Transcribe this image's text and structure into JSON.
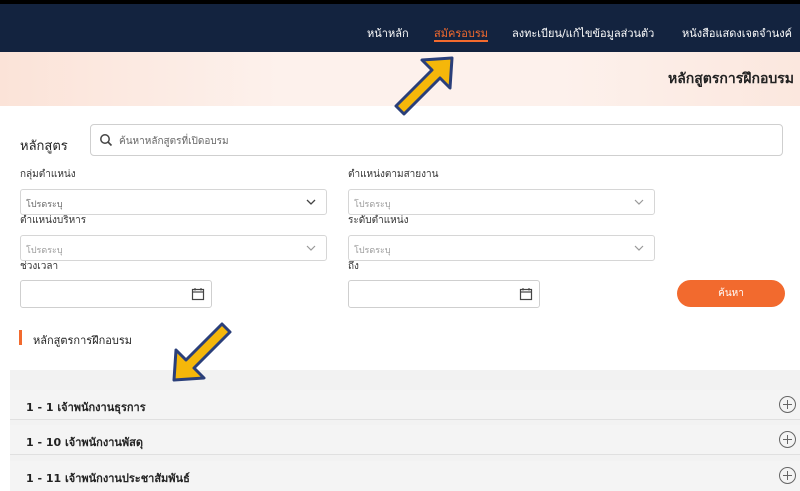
{
  "nav": {
    "items": [
      {
        "label": "หน้าหลัก",
        "active": false
      },
      {
        "label": "สมัครอบรม",
        "active": true
      },
      {
        "label": "ลงทะเบียน/แก้ไขข้อมูลส่วนตัว",
        "active": false
      },
      {
        "label": "หนังสือแสดงเจตจำนงค์",
        "active": false
      }
    ]
  },
  "banner": {
    "title": "หลักสูตรการฝึกอบรม"
  },
  "search": {
    "label": "หลักสูตร",
    "placeholder": "ค้นหาหลักสูตรที่เปิดอบรม"
  },
  "filters": {
    "group_label": "กลุ่มตำแหน่ง",
    "group_value": "โปรดระบุ",
    "line_label": "ตำแหน่งตามสายงาน",
    "line_value": "โปรดระบุ",
    "admin_label": "ตำแหน่งบริหาร",
    "admin_value": "โปรดระบุ",
    "level_label": "ระดับตำแหน่ง",
    "level_value": "โปรดระบุ",
    "period_label": "ช่วงเวลา",
    "to_label": "ถึง",
    "search_button": "ค้นหา"
  },
  "section": {
    "title": "หลักสูตรการฝึกอบรม"
  },
  "courses": [
    {
      "title": "1 - 1 เจ้าพนักงานธุรการ"
    },
    {
      "title": "1 - 10 เจ้าพนักงานพัสดุ"
    },
    {
      "title": "1 - 11 เจ้าพนักงานประชาสัมพันธ์"
    }
  ],
  "colors": {
    "accent": "#f26a2e",
    "nav_bg": "#13233f",
    "arrow_fill": "#f5b70a",
    "arrow_stroke": "#2a3f7a"
  }
}
